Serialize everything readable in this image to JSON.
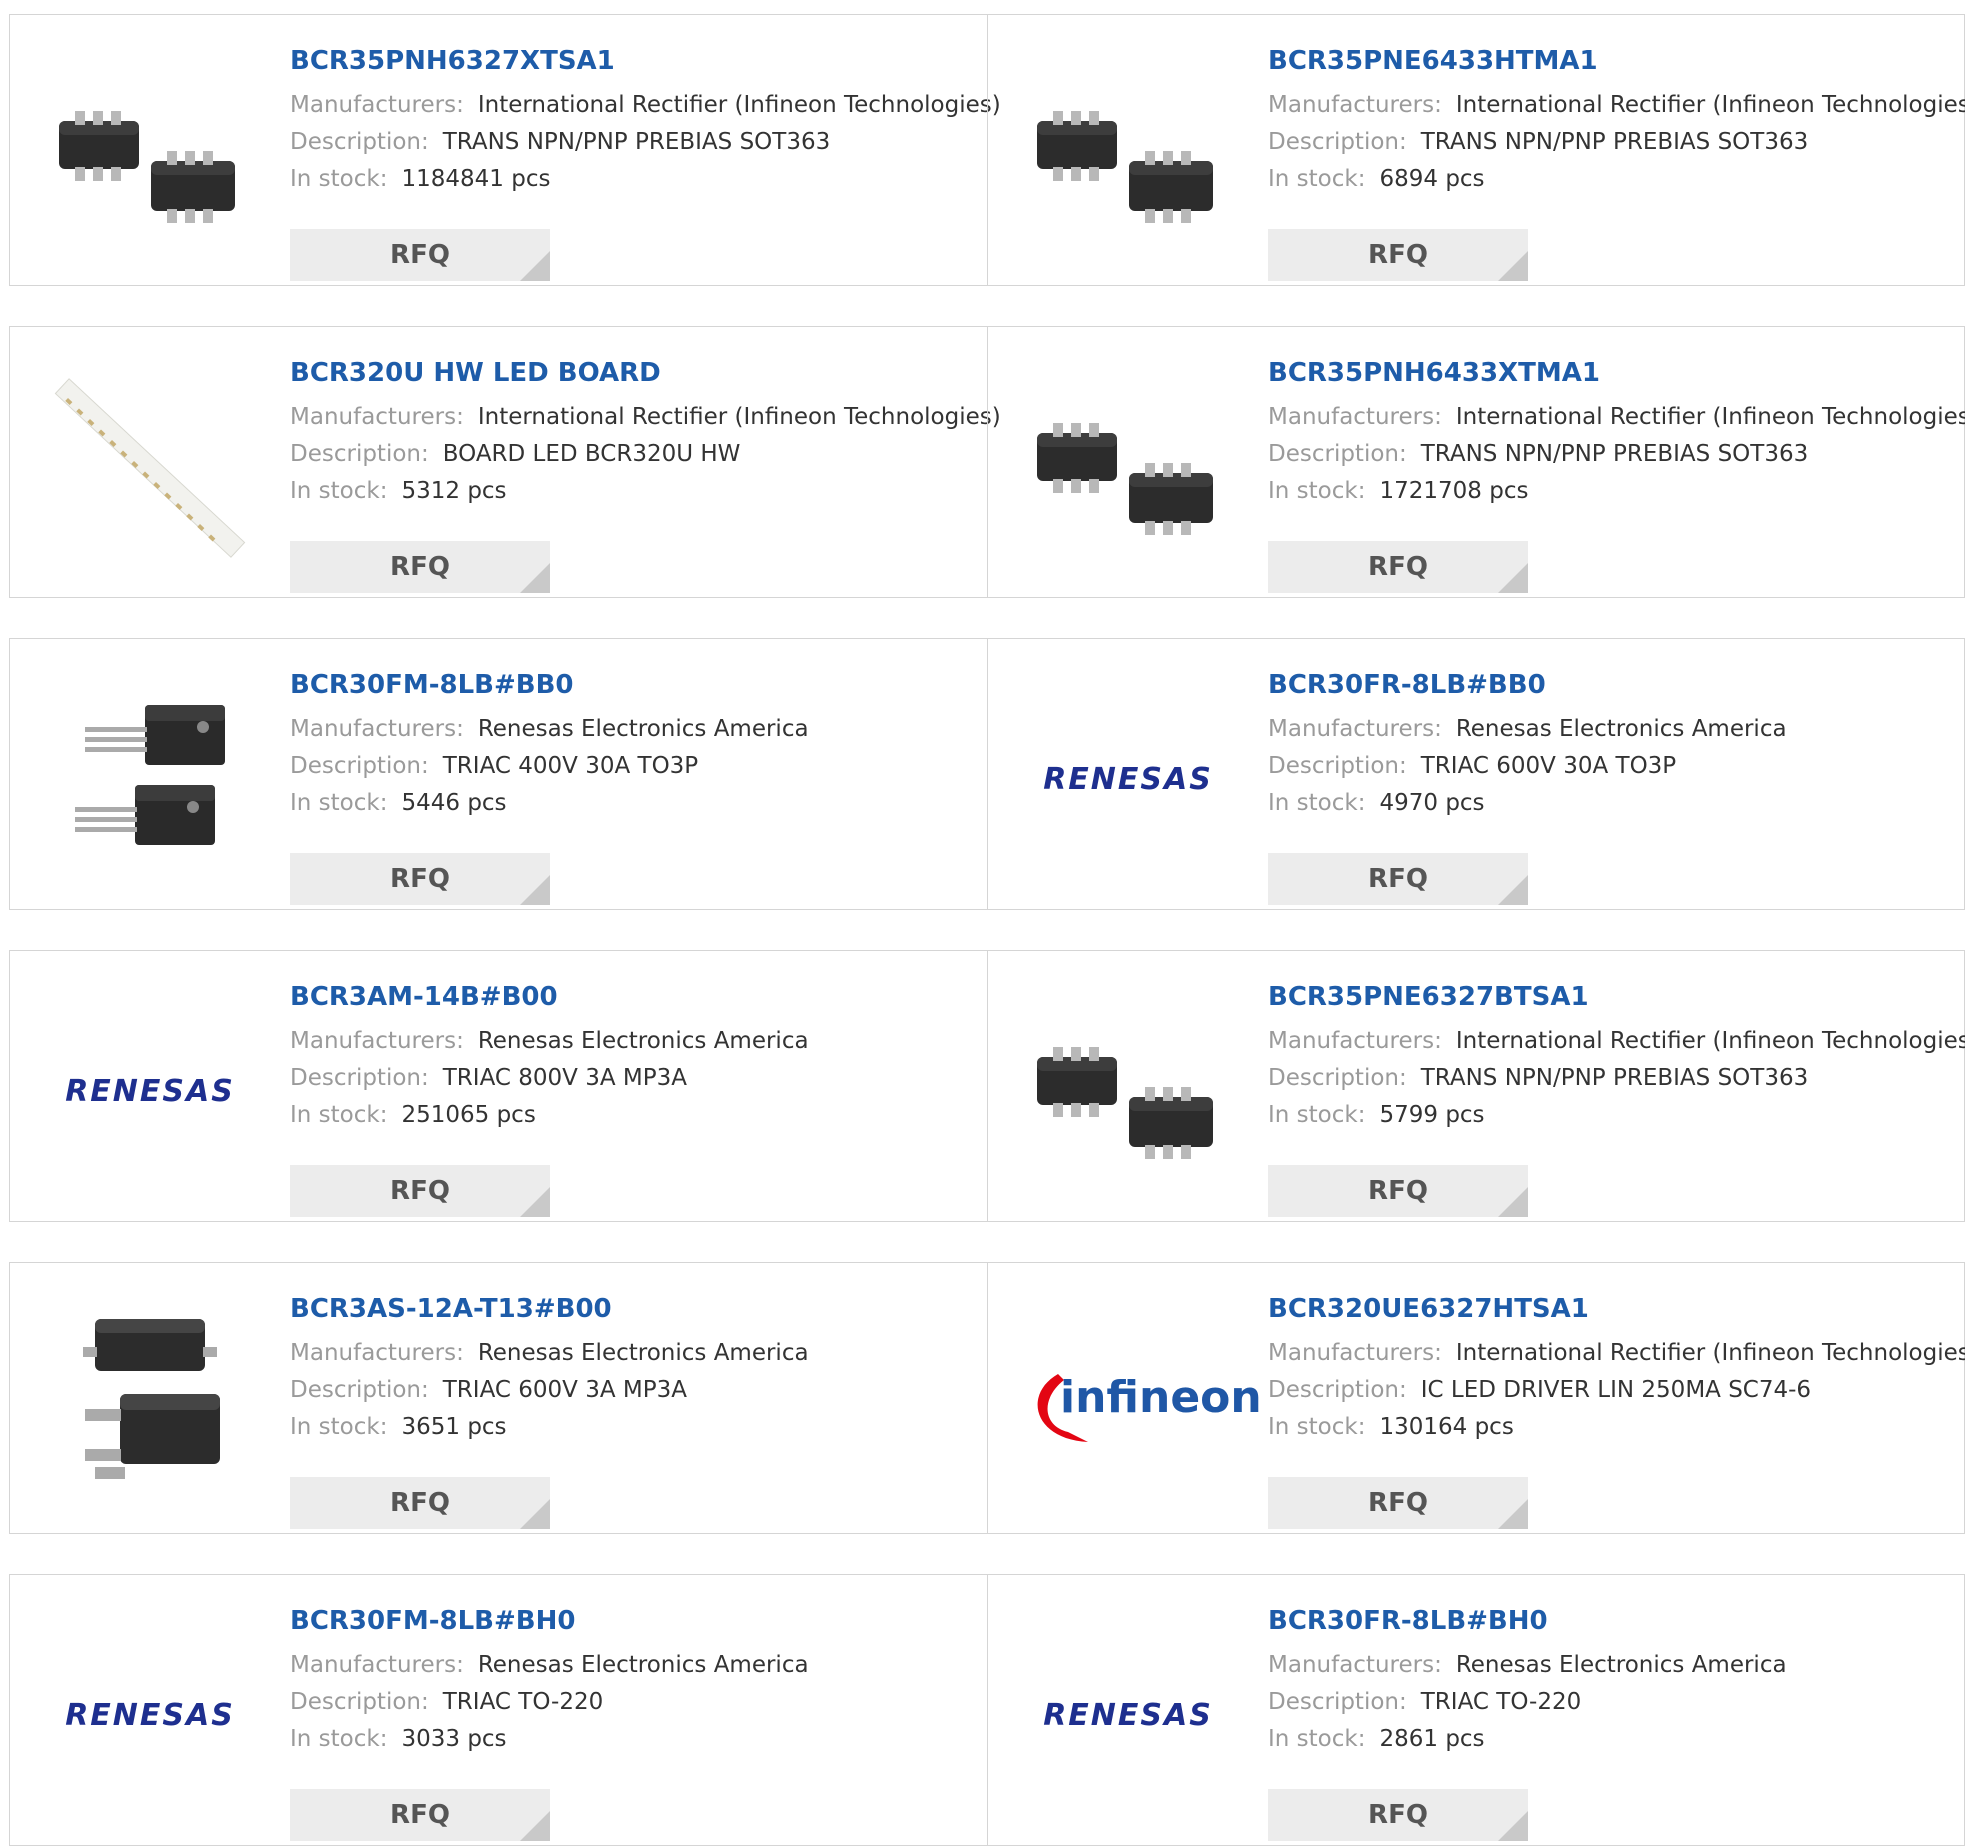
{
  "labels": {
    "manufacturers": "Manufacturers:",
    "description": "Description:",
    "in_stock": "In stock:",
    "rfq": "RFQ"
  },
  "products": [
    {
      "part": "BCR35PNH6327XTSA1",
      "manufacturer": "International Rectifier (Infineon Technologies)",
      "description": "TRANS NPN/PNP PREBIAS SOT363",
      "stock": "1184841 pcs",
      "image": "sot363-chip-image"
    },
    {
      "part": "BCR35PNE6433HTMA1",
      "manufacturer": "International Rectifier (Infineon Technologies)",
      "description": "TRANS NPN/PNP PREBIAS SOT363",
      "stock": "6894 pcs",
      "image": "sot363-chip-image"
    },
    {
      "part": "BCR320U HW LED BOARD",
      "manufacturer": "International Rectifier (Infineon Technologies)",
      "description": "BOARD LED BCR320U HW",
      "stock": "5312 pcs",
      "image": "led-board-image"
    },
    {
      "part": "BCR35PNH6433XTMA1",
      "manufacturer": "International Rectifier (Infineon Technologies)",
      "description": "TRANS NPN/PNP PREBIAS SOT363",
      "stock": "1721708 pcs",
      "image": "sot363-chip-image"
    },
    {
      "part": "BCR30FM-8LB#BB0",
      "manufacturer": "Renesas Electronics America",
      "description": "TRIAC 400V 30A TO3P",
      "stock": "5446 pcs",
      "image": "to220-package-image"
    },
    {
      "part": "BCR30FR-8LB#BB0",
      "manufacturer": "Renesas Electronics America",
      "description": "TRIAC 600V 30A TO3P",
      "stock": "4970 pcs",
      "image": "renesas-logo"
    },
    {
      "part": "BCR3AM-14B#B00",
      "manufacturer": "Renesas Electronics America",
      "description": "TRIAC 800V 3A MP3A",
      "stock": "251065 pcs",
      "image": "renesas-logo"
    },
    {
      "part": "BCR35PNE6327BTSA1",
      "manufacturer": "International Rectifier (Infineon Technologies)",
      "description": "TRANS NPN/PNP PREBIAS SOT363",
      "stock": "5799 pcs",
      "image": "sot363-chip-image"
    },
    {
      "part": "BCR3AS-12A-T13#B00",
      "manufacturer": "Renesas Electronics America",
      "description": "TRIAC 600V 3A MP3A",
      "stock": "3651 pcs",
      "image": "dpak-package-image"
    },
    {
      "part": "BCR320UE6327HTSA1",
      "manufacturer": "International Rectifier (Infineon Technologies)",
      "description": "IC LED DRIVER LIN 250MA SC74-6",
      "stock": "130164 pcs",
      "image": "infineon-logo"
    },
    {
      "part": "BCR30FM-8LB#BH0",
      "manufacturer": "Renesas Electronics America",
      "description": "TRIAC TO-220",
      "stock": "3033 pcs",
      "image": "renesas-logo"
    },
    {
      "part": "BCR30FR-8LB#BH0",
      "manufacturer": "Renesas Electronics America",
      "description": "TRIAC TO-220",
      "stock": "2861 pcs",
      "image": "renesas-logo"
    }
  ],
  "logos": {
    "renesas": "RENESAS",
    "infineon": "infineon"
  },
  "colors": {
    "link": "#1e5ca9",
    "label": "#9a9a9a",
    "border": "#d5d5d5",
    "button_bg": "#ececec",
    "renesas_blue": "#1e2f8f",
    "infineon_red": "#e30613"
  }
}
